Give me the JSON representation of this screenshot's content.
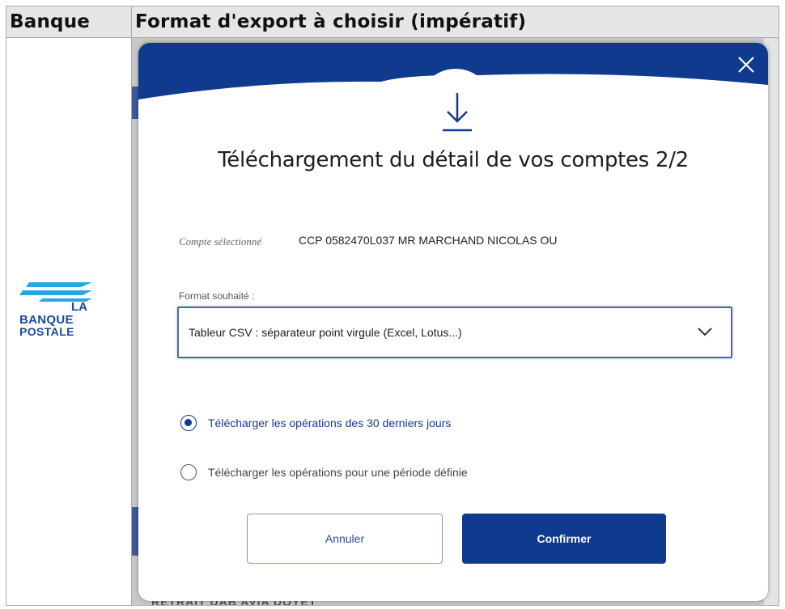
{
  "table": {
    "header_bank": "Banque",
    "header_format": "Format d'export à choisir (impératif)"
  },
  "logo": {
    "line1": "LA",
    "line2": "BANQUE",
    "line3": "POSTALE"
  },
  "background": {
    "bottom_text": "RETRAIT DAB AVIA DOYET"
  },
  "modal": {
    "title": "Téléchargement du détail de vos comptes 2/2",
    "account_label": "Compte sélectionné",
    "account_value": "CCP 0582470L037 MR MARCHAND NICOLAS OU",
    "format_label": "Format souhaité :",
    "format_selected": "Tableur CSV : séparateur point virgule (Excel, Lotus...)",
    "option_1": "Télécharger les opérations des 30 derniers jours",
    "option_2": "Télécharger les opérations pour une période définie",
    "selected_option": 1,
    "cancel_label": "Annuler",
    "confirm_label": "Confirmer"
  },
  "colors": {
    "brand_blue": "#0f3a8e",
    "header_bg": "#e6e6e6"
  }
}
